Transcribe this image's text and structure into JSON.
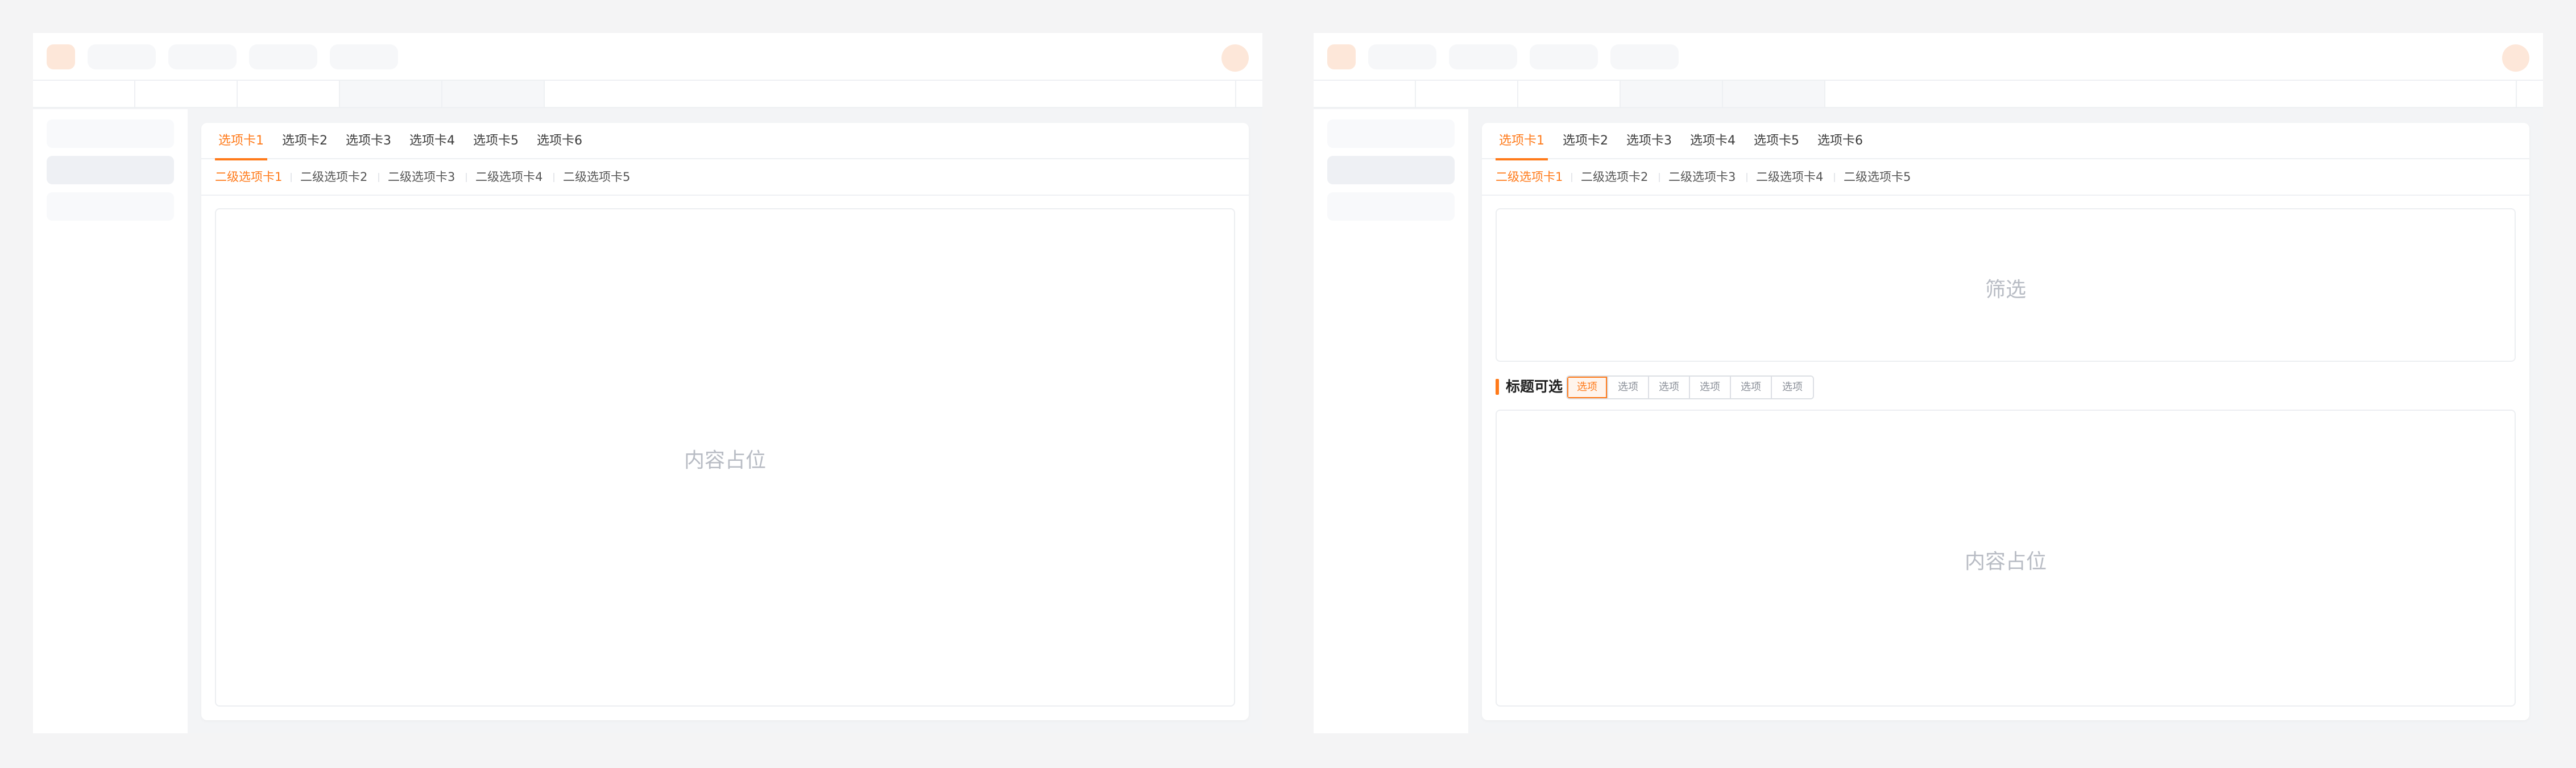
{
  "left_window": {
    "tabs": [
      {
        "label": "选项卡1",
        "active": true
      },
      {
        "label": "选项卡2"
      },
      {
        "label": "选项卡3"
      },
      {
        "label": "选项卡4"
      },
      {
        "label": "选项卡5"
      },
      {
        "label": "选项卡6"
      }
    ],
    "subtabs": [
      {
        "label": "二级选项卡1",
        "active": true
      },
      {
        "label": "二级选项卡2"
      },
      {
        "label": "二级选项卡3"
      },
      {
        "label": "二级选项卡4"
      },
      {
        "label": "二级选项卡5"
      }
    ],
    "content_placeholder": "内容占位"
  },
  "right_window": {
    "tabs": [
      {
        "label": "选项卡1",
        "active": true
      },
      {
        "label": "选项卡2"
      },
      {
        "label": "选项卡3"
      },
      {
        "label": "选项卡4"
      },
      {
        "label": "选项卡5"
      },
      {
        "label": "选项卡6"
      }
    ],
    "subtabs": [
      {
        "label": "二级选项卡1",
        "active": true
      },
      {
        "label": "二级选项卡2"
      },
      {
        "label": "二级选项卡3"
      },
      {
        "label": "二级选项卡4"
      },
      {
        "label": "二级选项卡5"
      }
    ],
    "filter_placeholder": "筛选",
    "section_title": "标题可选",
    "segments": [
      "选项",
      "选项",
      "选项",
      "选项",
      "选项",
      "选项"
    ],
    "active_segment": 0,
    "content_placeholder": "内容占位"
  },
  "colors": {
    "accent": "#ff7a1a",
    "background": "#f4f4f5",
    "placeholder_text": "#b8bcc4"
  }
}
